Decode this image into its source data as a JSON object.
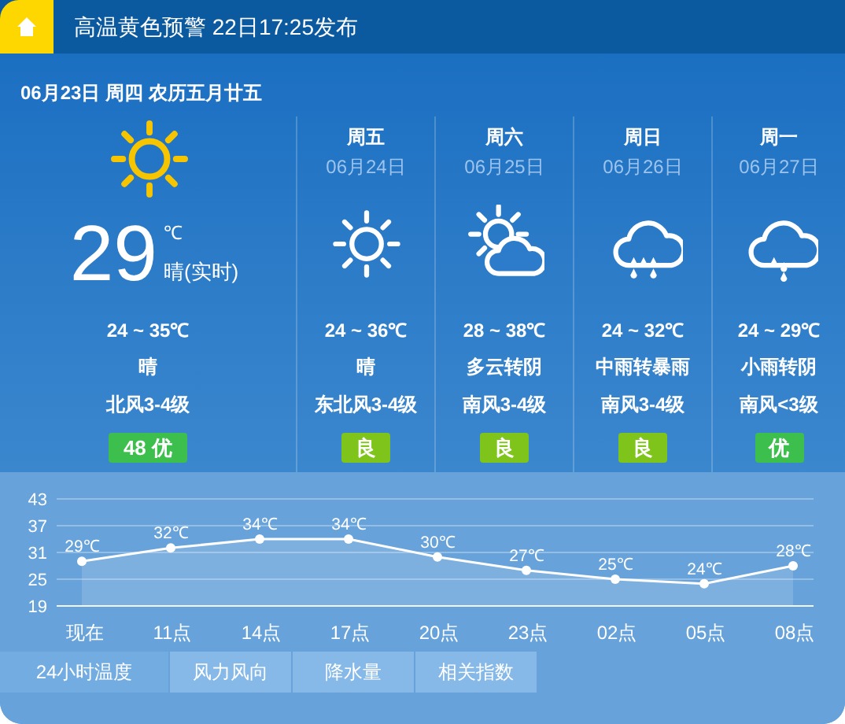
{
  "alert": {
    "text": "高温黄色预警 22日17:25发布"
  },
  "today": {
    "date_line": "06月23日 周四 农历五月廿五",
    "kind": "sunny",
    "temperature": "29",
    "unit": "℃",
    "condition_now": "晴(实时)",
    "range": "24 ~ 35℃",
    "condition": "晴",
    "wind": "北风3-4级",
    "aqi": "48 优",
    "color": "#3dbf4e"
  },
  "forecast": [
    {
      "weekday": "周五",
      "date": "06月24日",
      "kind": "sunny",
      "range": "24 ~ 36℃",
      "condition": "晴",
      "wind": "东北风3-4级",
      "aqi": "良",
      "color": "#7ec41b"
    },
    {
      "weekday": "周六",
      "date": "06月25日",
      "kind": "partly_cloudy",
      "range": "28 ~ 38℃",
      "condition": "多云转阴",
      "wind": "南风3-4级",
      "aqi": "良",
      "color": "#7ec41b"
    },
    {
      "weekday": "周日",
      "date": "06月26日",
      "kind": "heavy_rain",
      "range": "24 ~ 32℃",
      "condition": "中雨转暴雨",
      "wind": "南风3-4级",
      "aqi": "良",
      "color": "#7ec41b"
    },
    {
      "weekday": "周一",
      "date": "06月27日",
      "kind": "light_rain",
      "range": "24 ~ 29℃",
      "condition": "小雨转阴",
      "wind": "南风<3级",
      "aqi": "优",
      "color": "#3dbf4e"
    }
  ],
  "hourly": {
    "chart_data": {
      "type": "area",
      "categories": [
        "现在",
        "11点",
        "14点",
        "17点",
        "20点",
        "23点",
        "02点",
        "05点",
        "08点"
      ],
      "series": [
        {
          "color": "#ffffff",
          "values": [
            29,
            32,
            34,
            34,
            30,
            27,
            25,
            24,
            28
          ]
        }
      ],
      "ylim": [
        19,
        43
      ],
      "grid": true,
      "yticks": [
        19,
        25,
        31,
        37,
        43
      ],
      "value_labels": [
        "29℃",
        "32℃",
        "34℃",
        "34℃",
        "30℃",
        "27℃",
        "25℃",
        "24℃",
        "28℃"
      ]
    }
  },
  "tabs": [
    {
      "label": "24小时温度",
      "selected": true
    },
    {
      "label": "风力风向",
      "selected": false
    },
    {
      "label": "降水量",
      "selected": false
    },
    {
      "label": "相关指数",
      "selected": false
    }
  ]
}
